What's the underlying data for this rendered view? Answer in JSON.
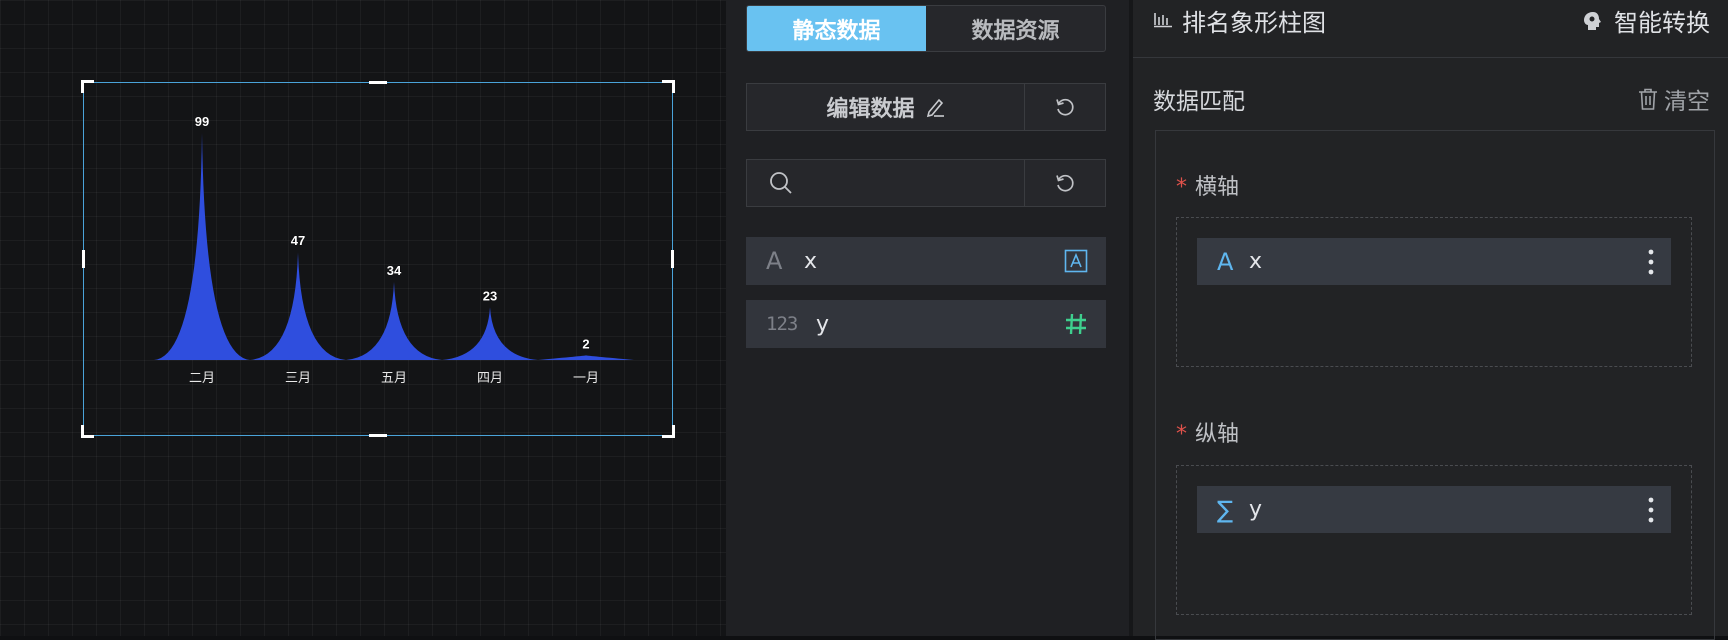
{
  "chart_data": {
    "type": "bar",
    "categories": [
      "二月",
      "三月",
      "五月",
      "四月",
      "一月"
    ],
    "values": [
      99,
      47,
      34,
      23,
      2
    ],
    "ylim": [
      0,
      99
    ],
    "bar_color": "#2f4ede",
    "title": "",
    "xlabel": "",
    "ylabel": ""
  },
  "data_panel": {
    "tabs": [
      {
        "label": "静态数据",
        "active": true
      },
      {
        "label": "数据资源",
        "active": false
      }
    ],
    "edit_label": "编辑数据",
    "search_placeholder": "",
    "fields": [
      {
        "type_glyph": "A",
        "name": "x",
        "badge_icon": "text-field-icon"
      },
      {
        "type_glyph": "123",
        "name": "y",
        "badge_icon": "hash-icon"
      }
    ]
  },
  "config_panel": {
    "chart_type_name": "排名象形柱图",
    "smart_convert_label": "智能转换",
    "match_title": "数据匹配",
    "clear_label": "清空",
    "x_axis": {
      "title": "横轴",
      "required": "*",
      "item_glyph": "A",
      "item_name": "x"
    },
    "y_axis": {
      "title": "纵轴",
      "required": "*",
      "item_glyph": "∑",
      "item_name": "y"
    }
  },
  "colors": {
    "accent": "#69c2f1",
    "hash": "#3ecf8e",
    "required": "#e0524b"
  }
}
